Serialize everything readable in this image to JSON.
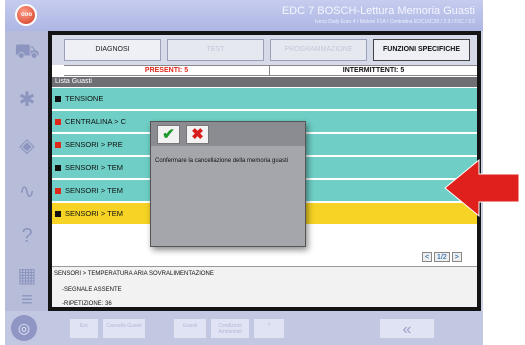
{
  "window": {
    "title": "EDC 7 BOSCH-Lettura Memoria Guasti",
    "subtitle": "Iveco Daily Euro 4 / Motore F1A / Centralina EDC16C39 / 2.3 / F1C / 3.0",
    "power_label": "ooo"
  },
  "tabs": [
    {
      "label": "DIAGNOSI",
      "enabled": true
    },
    {
      "label": "TEST",
      "enabled": false
    },
    {
      "label": "PROGRAMMAZIONE",
      "enabled": false
    },
    {
      "label": "FUNZIONI SPECIFICHE",
      "enabled": true,
      "active": true
    }
  ],
  "counters": {
    "present": "PRESENTI: 5",
    "intermittent": "INTERMITTENTI: 5"
  },
  "list": {
    "header": "Lista Guasti",
    "rows": [
      {
        "label": "TENSIONE",
        "status": "intermittent",
        "bg": "#6fcfc6"
      },
      {
        "label": "CENTRALINA > C",
        "status": "present",
        "bg": "#6fcfc6"
      },
      {
        "label": "SENSORI > PRE",
        "status": "present",
        "bg": "#6fcfc6"
      },
      {
        "label": "SENSORI > TEM",
        "status": "intermittent",
        "bg": "#6fcfc6"
      },
      {
        "label": "SENSORI > TEM",
        "status": "present",
        "bg": "#6fcfc6"
      },
      {
        "label": "SENSORI > TEM",
        "status": "intermittent",
        "bg": "#f6d324"
      }
    ],
    "status_colors": {
      "present": "#e0281a",
      "intermittent": "#111111"
    }
  },
  "pager": {
    "prev": "<",
    "page": "1/2",
    "next": ">"
  },
  "detail": {
    "title": "SENSORI > TEMPERATURA ARIA SOVRALIMENTAZIONE",
    "line1": "-SEGNALE ASSENTE",
    "line2": "-RIPETIZIONE: 36"
  },
  "dialog": {
    "confirm_icon": "check-icon",
    "cancel_icon": "x-icon",
    "message": "Confermare la cancellazione della memoria guasti",
    "confirm_color": "#1f9a2c",
    "cancel_color": "#d81c1c"
  },
  "bottom": {
    "buttons": [
      "Esc",
      "Cancella Guasti",
      "Guasti",
      "Condizioni Ambientali",
      "?"
    ],
    "back_icon": "double-chevron-left-icon"
  },
  "sidebar_icons": [
    "truck-icon",
    "wrench-icon",
    "database-icon",
    "chart-icon",
    "help-icon",
    "printer-icon",
    "gauge-icon"
  ],
  "colors": {
    "accent_arrow": "#e0201c",
    "highlight_row": "#f6d324",
    "normal_row": "#6fcfc6"
  }
}
